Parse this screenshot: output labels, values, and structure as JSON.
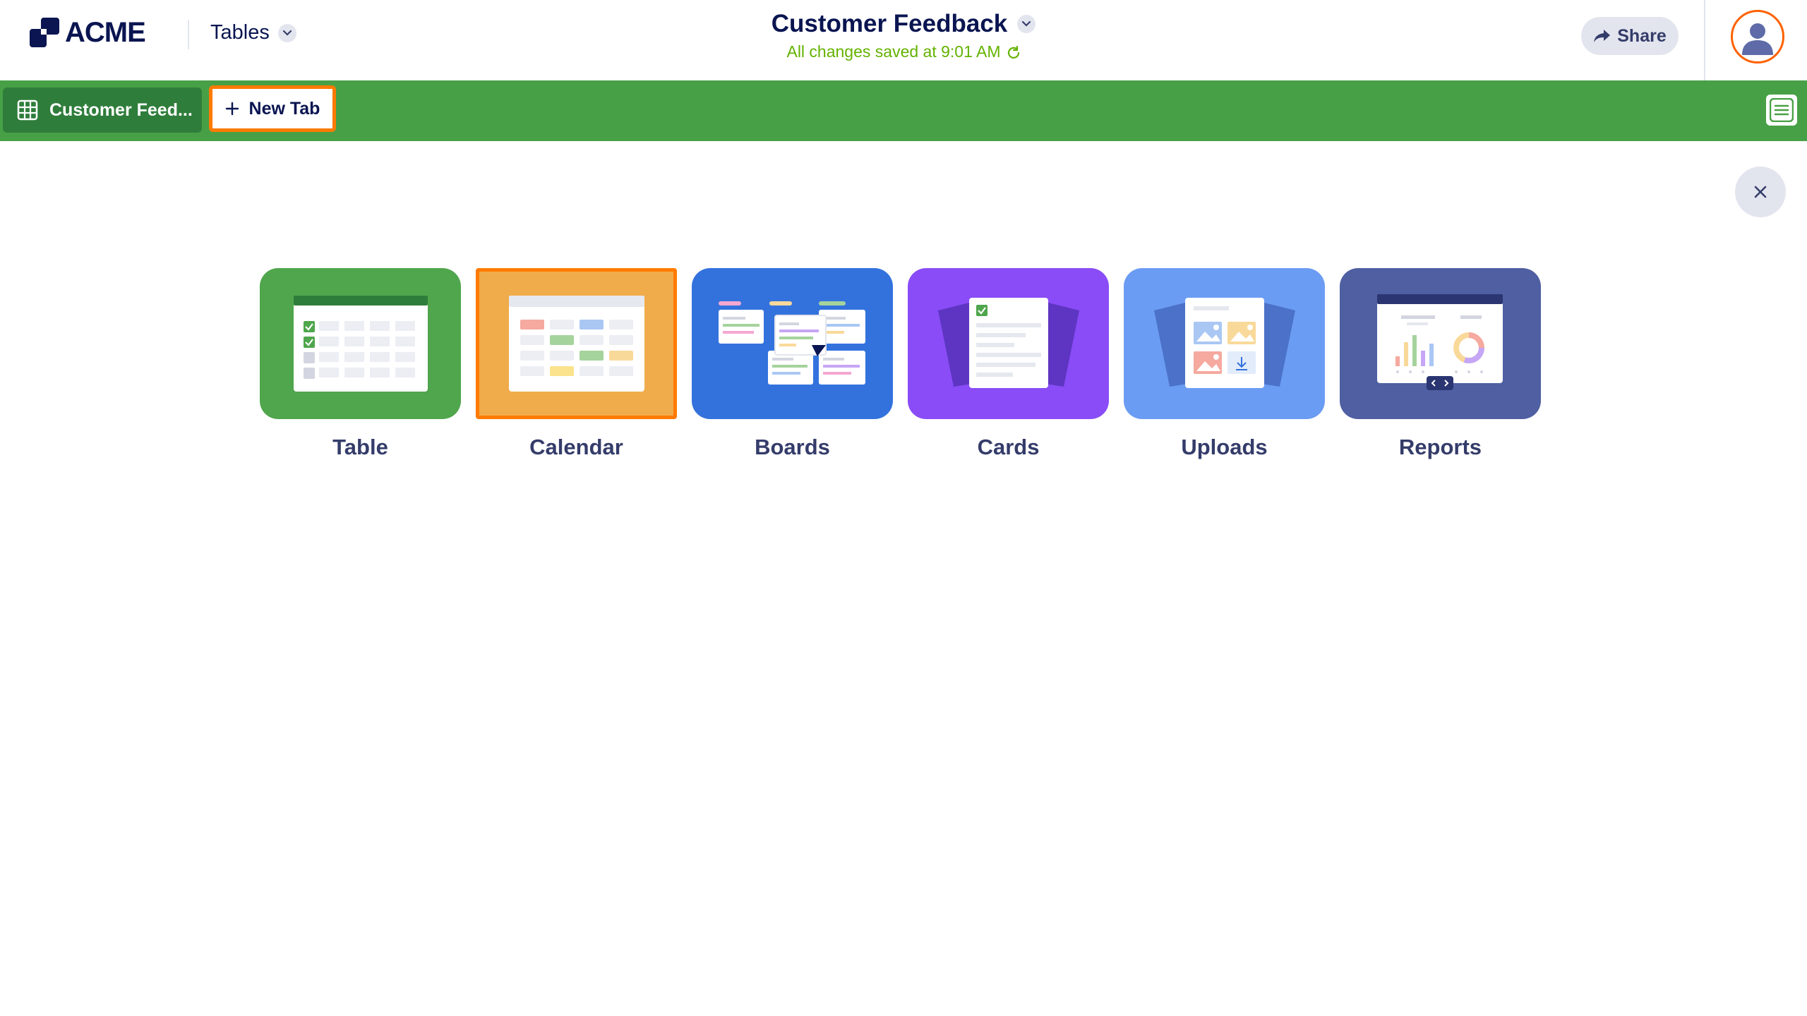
{
  "brand": {
    "name": "ACME"
  },
  "header": {
    "product_label": "Tables",
    "doc_title": "Customer Feedback",
    "save_status": "All changes saved at 9:01 AM",
    "share_label": "Share"
  },
  "tabs": {
    "active_label": "Customer Feed...",
    "new_tab_label": "New Tab"
  },
  "options": [
    {
      "label": "Table",
      "color": "#4fa64c",
      "icon": "table-icon"
    },
    {
      "label": "Calendar",
      "color": "#f0ac4b",
      "icon": "calendar-icon",
      "selected": true
    },
    {
      "label": "Boards",
      "color": "#3372dd",
      "icon": "boards-icon"
    },
    {
      "label": "Cards",
      "color": "#8a4cf6",
      "icon": "cards-icon"
    },
    {
      "label": "Uploads",
      "color": "#6b9cf4",
      "icon": "uploads-icon"
    },
    {
      "label": "Reports",
      "color": "#4f5fa2",
      "icon": "reports-icon"
    }
  ],
  "colors": {
    "tabbar": "#48a046",
    "active_tab": "#2f7d3b",
    "highlight": "#ff7a00",
    "navy": "#0a1551",
    "saved_green": "#64b200"
  }
}
